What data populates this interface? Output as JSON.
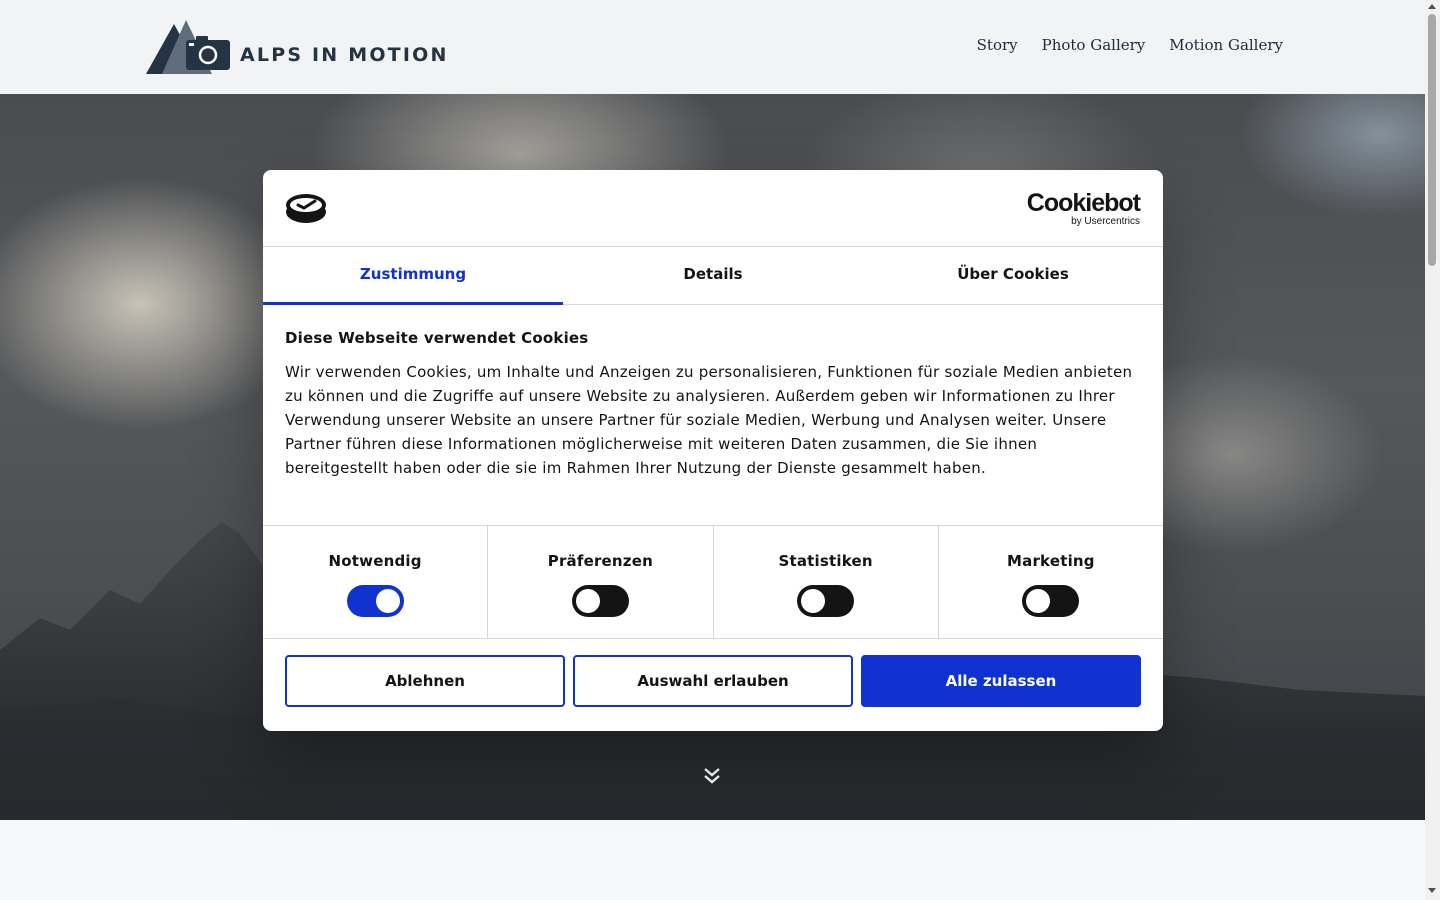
{
  "header": {
    "logo_text": "ALPS IN MOTION",
    "nav": [
      "Story",
      "Photo Gallery",
      "Motion Gallery"
    ]
  },
  "cookie_dialog": {
    "provider_name": "Cookiebot",
    "provider_by": "by Usercentrics",
    "tabs": [
      {
        "label": "Zustimmung",
        "active": true
      },
      {
        "label": "Details",
        "active": false
      },
      {
        "label": "Über Cookies",
        "active": false
      }
    ],
    "title": "Diese Webseite verwendet Cookies",
    "body": "Wir verwenden Cookies, um Inhalte und Anzeigen zu personalisieren, Funktionen für soziale Medien anbieten zu können und die Zugriffe auf unsere Website zu analysieren. Außerdem geben wir Informationen zu Ihrer Verwendung unserer Website an unsere Partner für soziale Medien, Werbung und Analysen weiter. Unsere Partner führen diese Informationen möglicherweise mit weiteren Daten zusammen, die Sie ihnen bereitgestellt haben oder die sie im Rahmen Ihrer Nutzung der Dienste gesammelt haben.",
    "categories": [
      {
        "label": "Notwendig",
        "enabled": true
      },
      {
        "label": "Präferenzen",
        "enabled": false
      },
      {
        "label": "Statistiken",
        "enabled": false
      },
      {
        "label": "Marketing",
        "enabled": false
      }
    ],
    "buttons": {
      "reject": "Ablehnen",
      "allow_selection": "Auswahl erlauben",
      "allow_all": "Alle zulassen"
    }
  },
  "colors": {
    "accent": "#1032cf",
    "header_bg": "#f1f3f5",
    "logo_dark": "#253444",
    "logo_slate": "#5f6e7a",
    "toggle_off": "#141414"
  },
  "icons": {
    "logo": "mountain-camera-icon",
    "scroll": "double-chevron-down-icon",
    "consent": "cookie-consent-icon"
  }
}
